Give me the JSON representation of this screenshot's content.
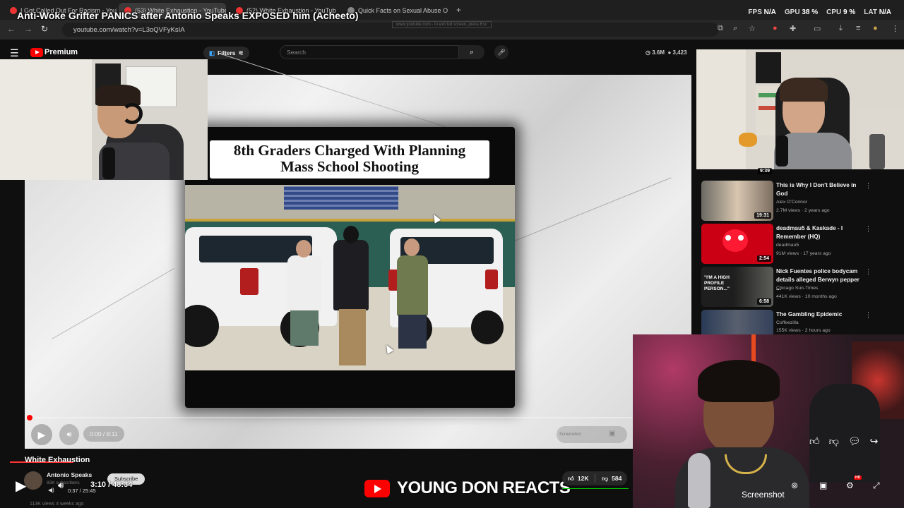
{
  "browser": {
    "tabs": [
      {
        "label": "I Got Called Out For Racism - YouTube"
      },
      {
        "label": "(53) White Exhaustion - YouTube"
      },
      {
        "label": "(52) White Exhaustion - YouTube"
      },
      {
        "label": "Quick Facts on Sexual Abuse Of"
      }
    ],
    "overlay_title": "Anti-Woke Grifter PANICS after Antonio Speaks EXPOSED him (Acheeto)",
    "url": "youtube.com/watch?v=L3oQVFyKsIA",
    "fullscreen_note": "www.youtube.com - to exit full screen, press Esc",
    "stats": {
      "fps_label": "FPS",
      "fps": "N/A",
      "gpu_label": "GPU",
      "gpu": "38 %",
      "cpu_label": "CPU",
      "cpu": "9 %",
      "lat_label": "LAT",
      "lat": "N/A"
    }
  },
  "youtube": {
    "brand": "Premium",
    "filters_label": "Filters",
    "search_placeholder": "Search",
    "stat_a": "3.6M",
    "stat_b": "3,423"
  },
  "video": {
    "headline_line1": "8th Graders Charged With Planning",
    "headline_line2": "Mass School Shooting",
    "time": "0:00 / 8:11",
    "cc_label": "Screenshot"
  },
  "recommendations": [
    {
      "title": "This is Why I Don't Believe in God",
      "channel": "Alex O'Connor",
      "meta": "2.7M views · 2 years ago",
      "duration": "19:31"
    },
    {
      "title": "deadmau5 & Kaskade - I Remember (HQ)",
      "channel": "deadmau5",
      "meta": "91M views · 17 years ago",
      "duration": "2:54"
    },
    {
      "title": "Nick Fuentes police bodycam details alleged Berwyn pepper ...",
      "channel": "Chicago Sun-Times",
      "meta": "441K views · 10 months ago",
      "duration": "6:58"
    },
    {
      "title": "The Gambling Epidemic",
      "channel": "Coffeezilla",
      "meta": "155K views · 2 hours ago",
      "duration": ""
    }
  ],
  "top_thumb_duration": "9:39",
  "bottom": {
    "video_title": "White Exhaustion",
    "channel_name": "Antonio Speaks",
    "channel_subs": "83K subscribers",
    "subscribe_label": "Subscribe",
    "main_time": "3:10 / 48:34",
    "small_time": "0:37 / 25:45",
    "views": "113K views 4 weeks ago",
    "brand_text": "YOUNG DON REACTS",
    "likes": "12K",
    "dislikes": "584",
    "screenshot_label": "Screenshot"
  }
}
